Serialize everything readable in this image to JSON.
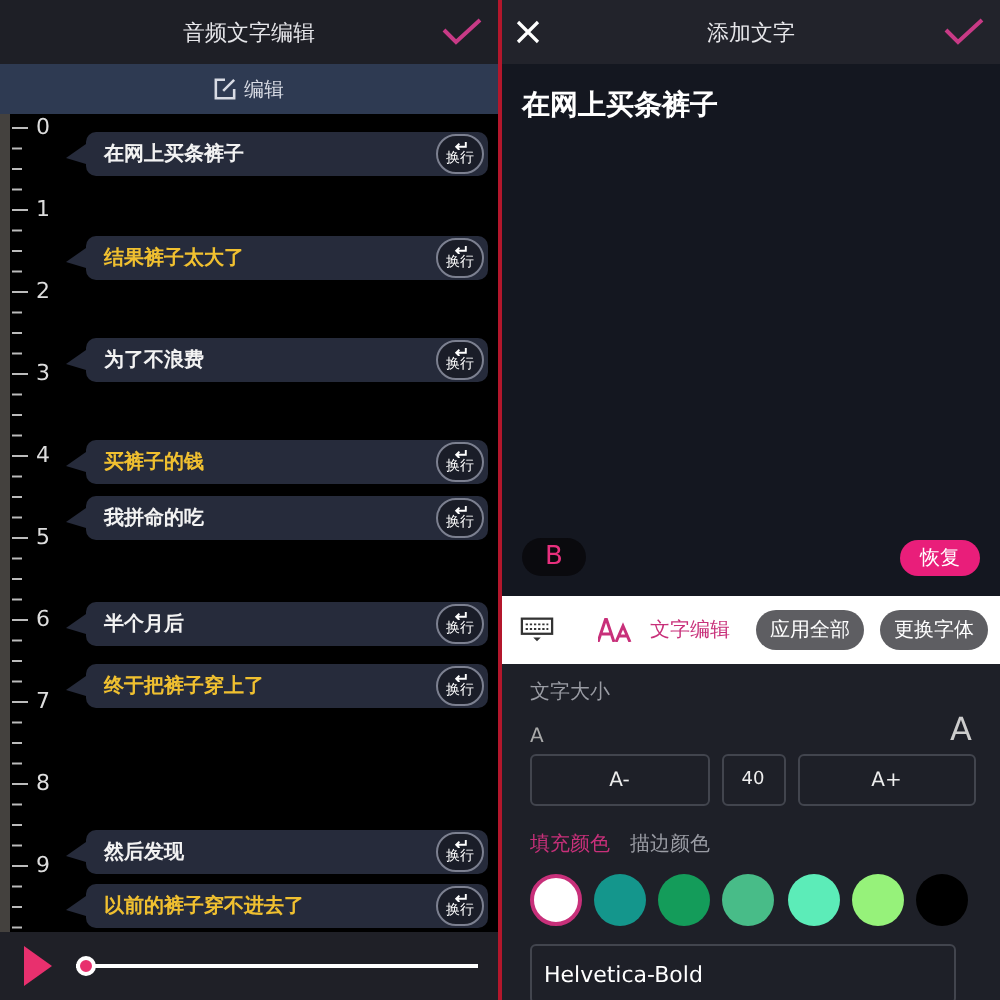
{
  "left": {
    "title": "音频文字编辑",
    "edit_label": "编辑",
    "ruler": [
      "0",
      "1",
      "2",
      "3",
      "4",
      "5",
      "6",
      "7",
      "8",
      "9"
    ],
    "subtitles": [
      {
        "text": "在网上买条裤子",
        "highlighted": false,
        "button": "换行"
      },
      {
        "text": "结果裤子太大了",
        "highlighted": true,
        "button": "换行"
      },
      {
        "text": "为了不浪费",
        "highlighted": false,
        "button": "换行"
      },
      {
        "text": "买裤子的钱",
        "highlighted": true,
        "button": "换行"
      },
      {
        "text": "我拼命的吃",
        "highlighted": false,
        "button": "换行"
      },
      {
        "text": "半个月后",
        "highlighted": false,
        "button": "换行"
      },
      {
        "text": "终于把裤子穿上了",
        "highlighted": true,
        "button": "换行"
      },
      {
        "text": "然后发现",
        "highlighted": false,
        "button": "换行"
      },
      {
        "text": "以前的裤子穿不进去了",
        "highlighted": true,
        "button": "换行"
      }
    ],
    "player": {
      "level": 0
    }
  },
  "right": {
    "title": "添加文字",
    "text": "在网上买条裤子",
    "bold": {
      "label": "B",
      "on": true
    },
    "reset": "恢复",
    "toolbar": {
      "edit_label": "文字编辑",
      "apply_all": "应用全部",
      "change_font": "更换字体"
    },
    "size": {
      "label": "文字大小",
      "small": "A",
      "large": "A",
      "minus": "A-",
      "value": "40",
      "plus": "A+"
    },
    "color_tabs": [
      {
        "label": "填充颜色",
        "selected": true
      },
      {
        "label": "描边颜色",
        "selected": false
      }
    ],
    "swatches": [
      {
        "color": "#ffffff",
        "selected": true
      },
      {
        "color": "#14968c",
        "selected": false
      },
      {
        "color": "#149c5a",
        "selected": false
      },
      {
        "color": "#48bc88",
        "selected": false
      },
      {
        "color": "#5cecb8",
        "selected": false
      },
      {
        "color": "#96f27a",
        "selected": false
      },
      {
        "color": "#000000",
        "selected": false
      }
    ],
    "font": "Helvetica-Bold"
  }
}
